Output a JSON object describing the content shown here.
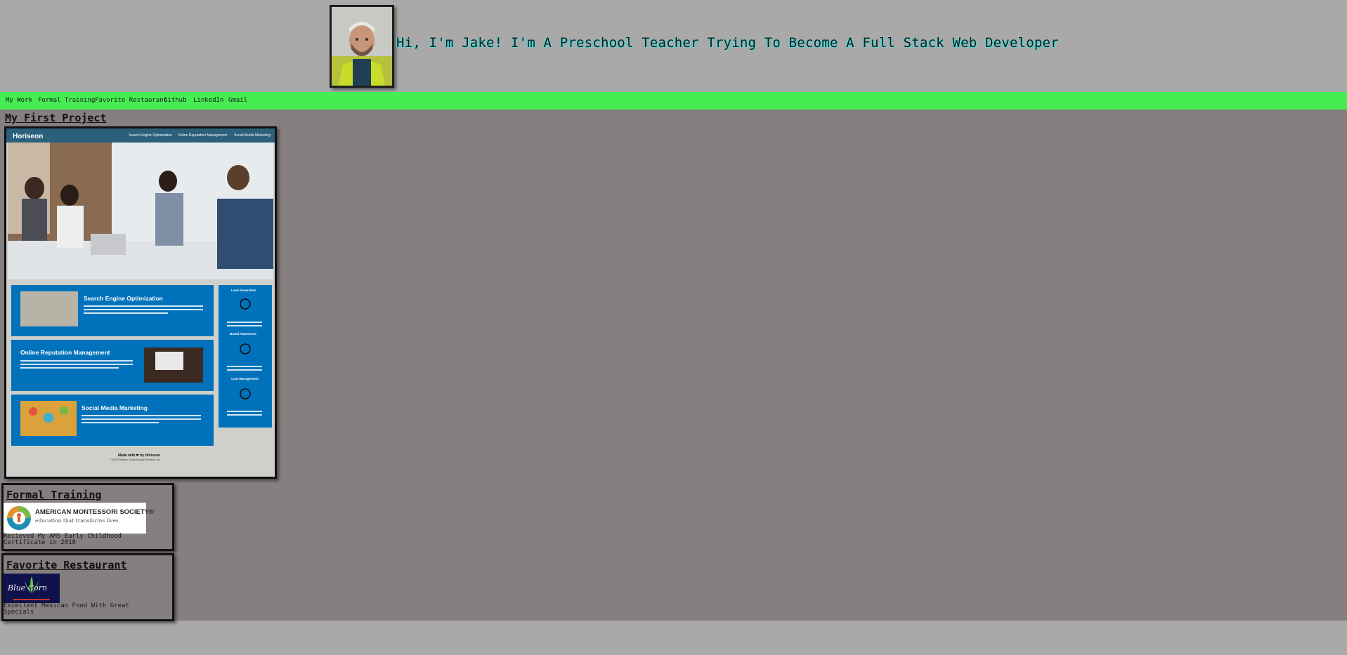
{
  "header": {
    "headline": "Hi, I'm Jake! I'm A Preschool Teacher Trying To Become A Full Stack Web Developer"
  },
  "nav": {
    "items": [
      "My Work",
      "Formal Training",
      "Favorite Restaurant",
      "Github",
      "LinkedIn",
      "Gmail"
    ]
  },
  "project": {
    "title": "My First Project",
    "screenshot": {
      "brand": "Horiseon",
      "nav": [
        "Search Engine Optimization",
        "Online Reputation Management",
        "Social Media Marketing"
      ],
      "cards": [
        "Search Engine Optimization",
        "Online Reputation Management",
        "Social Media Marketing"
      ],
      "sidebar": [
        "Lead Generation",
        "Brand Awareness",
        "Cost Management"
      ],
      "footer": "Made with ❤ by Horiseon",
      "copyright": "© 2019 Horiseon Social Solution Services, Inc."
    }
  },
  "training": {
    "title": "Formal Training",
    "logo_text": "AMERICAN MONTESSORI SOCIETY®",
    "logo_tagline": "education that transforms lives",
    "caption_line1": "Recieved My AMS Early Childhood",
    "caption_line2": "Certificate in 2018"
  },
  "restaurant": {
    "title": "Favorite Restaurant",
    "logo_text": "Blue Corn",
    "caption_line1": "Excellent Mexican Food With Great",
    "caption_line2": "Specials"
  },
  "colors": {
    "page_bg": "#a9a9a9",
    "nav_bg": "#45ec52",
    "main_bg": "#857f7f",
    "horiseon_blue": "#0072bb",
    "horiseon_header": "#2a607c"
  }
}
